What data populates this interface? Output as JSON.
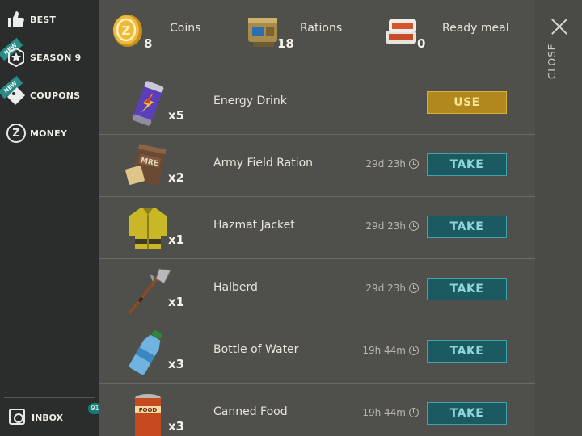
{
  "sidebar": {
    "items": [
      {
        "label": "BEST",
        "icon": "thumbs-up-icon"
      },
      {
        "label": "SEASON 9",
        "icon": "season-badge-icon",
        "new": "NEW"
      },
      {
        "label": "COUPONS",
        "icon": "coupon-icon",
        "new": "NEW"
      },
      {
        "label": "MONEY",
        "icon": "coin-icon"
      }
    ],
    "inbox": {
      "label": "INBOX",
      "badge": "91"
    }
  },
  "resources": [
    {
      "label": "Coins",
      "count": "8",
      "icon": "coin-icon"
    },
    {
      "label": "Rations",
      "count": "18",
      "icon": "ration-can-icon"
    },
    {
      "label": "Ready meal",
      "count": "0",
      "icon": "ready-meal-icon"
    }
  ],
  "items": [
    {
      "name": "Energy Drink",
      "qty": "x5",
      "timer": "",
      "action": "USE",
      "icon": "energy-drink-icon"
    },
    {
      "name": "Army Field Ration",
      "qty": "x2",
      "timer": "29d 23h",
      "action": "TAKE",
      "icon": "mre-icon"
    },
    {
      "name": "Hazmat Jacket",
      "qty": "x1",
      "timer": "29d 23h",
      "action": "TAKE",
      "icon": "hazmat-jacket-icon"
    },
    {
      "name": "Halberd",
      "qty": "x1",
      "timer": "29d 23h",
      "action": "TAKE",
      "icon": "halberd-icon"
    },
    {
      "name": "Bottle of Water",
      "qty": "x3",
      "timer": "19h 44m",
      "action": "TAKE",
      "icon": "water-bottle-icon"
    },
    {
      "name": "Canned Food",
      "qty": "x3",
      "timer": "19h 44m",
      "action": "TAKE",
      "icon": "canned-food-icon"
    }
  ],
  "close": {
    "label": "CLOSE"
  },
  "colors": {
    "take": "#1b5a60",
    "use": "#b0881e",
    "sidebar": "#2b2d2c",
    "panel": "#4f4f4b"
  }
}
